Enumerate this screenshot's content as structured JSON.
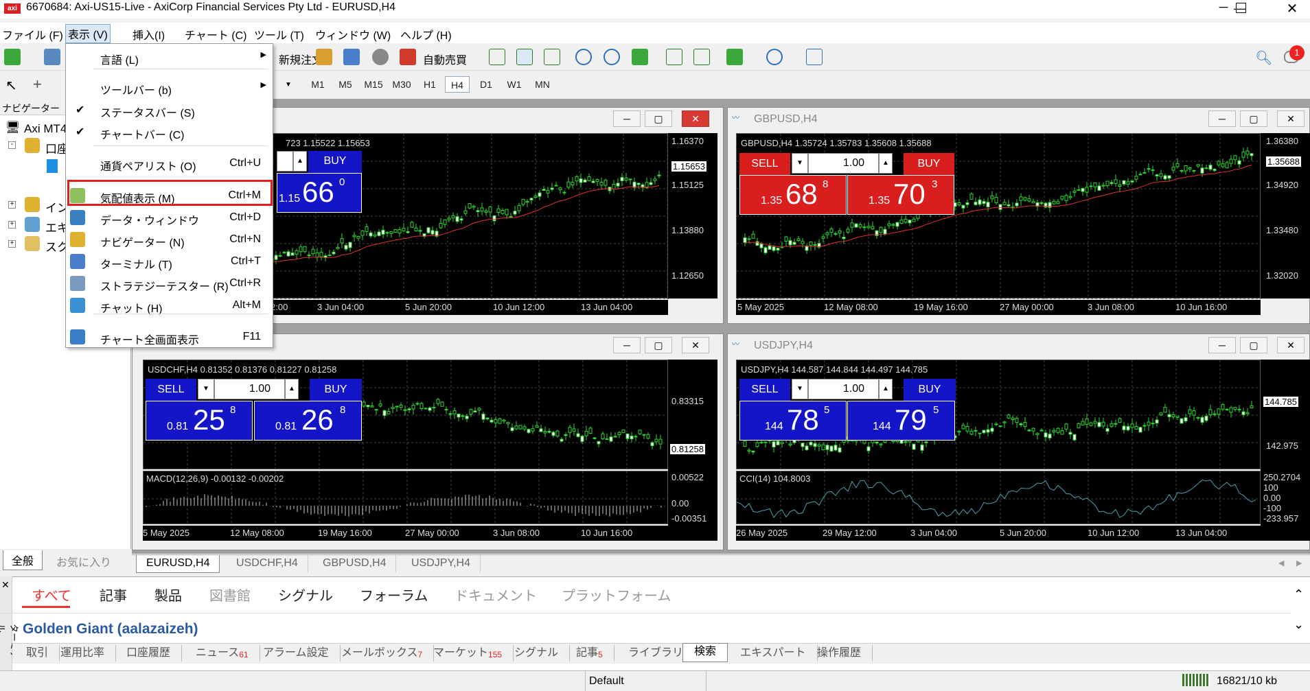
{
  "window": {
    "title": "6670684: Axi-US15-Live - AxiCorp Financial Services Pty Ltd - EURUSD,H4",
    "app_icon": "axi"
  },
  "menubar": {
    "items": [
      "ファイル (F)",
      "表示 (V)",
      "挿入(I)",
      "チャート (C)",
      "ツール (T)",
      "ウィンドウ (W)",
      "ヘルプ (H)"
    ]
  },
  "toolbar": {
    "new_order": "新規注文",
    "auto_trade": "自動売買",
    "notification_count": "1"
  },
  "timeframes": [
    "M1",
    "M5",
    "M15",
    "M30",
    "H1",
    "H4",
    "D1",
    "W1",
    "MN"
  ],
  "navigator": {
    "title": "ナビゲーター",
    "items": [
      "Axi MT4",
      "口座",
      "イン",
      "エキ",
      "スク"
    ],
    "tabs": [
      "全般",
      "お気に入り"
    ]
  },
  "view_menu": {
    "items": [
      {
        "label": "言語 (L)",
        "shortcut": "",
        "submenu": true
      },
      {
        "label": "ツールバー (b)",
        "shortcut": "",
        "submenu": true
      },
      {
        "label": "ステータスバー (S)",
        "shortcut": "",
        "checked": true
      },
      {
        "label": "チャートバー (C)",
        "shortcut": "",
        "checked": true
      },
      {
        "label": "通貨ペアリスト (O)",
        "shortcut": "Ctrl+U"
      },
      {
        "label": "気配値表示 (M)",
        "shortcut": "Ctrl+M",
        "highlighted": true
      },
      {
        "label": "データ・ウィンドウ",
        "shortcut": "Ctrl+D"
      },
      {
        "label": "ナビゲーター (N)",
        "shortcut": "Ctrl+N"
      },
      {
        "label": "ターミナル (T)",
        "shortcut": "Ctrl+T"
      },
      {
        "label": "ストラテジーテスター (R)",
        "shortcut": "Ctrl+R"
      },
      {
        "label": "チャット (H)",
        "shortcut": "Alt+M"
      },
      {
        "label": "チャート全画面表示",
        "shortcut": "F11"
      }
    ]
  },
  "charts": {
    "eurusd": {
      "info": "723 1.15522 1.15653",
      "buy_label": "BUY",
      "buy_prefix": "1.15",
      "buy_big": "66",
      "buy_sup": "0",
      "y_ticks": [
        "1.16370",
        "1.15653",
        "1.15125",
        "1.13880",
        "1.12650"
      ],
      "x_ticks": [
        "2:00",
        "3 Jun 04:00",
        "5 Jun 20:00",
        "10 Jun 12:00",
        "13 Jun 04:00"
      ],
      "current": "1.15653"
    },
    "gbpusd": {
      "title": "GBPUSD,H4",
      "info": "GBPUSD,H4  1.35724 1.35783 1.35608 1.35688",
      "sell_label": "SELL",
      "buy_label": "BUY",
      "lot": "1.00",
      "sell_prefix": "1.35",
      "sell_big": "68",
      "sell_sup": "8",
      "buy_prefix": "1.35",
      "buy_big": "70",
      "buy_sup": "3",
      "y_ticks": [
        "1.36380",
        "1.35688",
        "1.34920",
        "1.33480",
        "1.32020"
      ],
      "x_ticks": [
        "5 May 2025",
        "12 May 08:00",
        "19 May 16:00",
        "27 May 00:00",
        "3 Jun 08:00",
        "10 Jun 16:00"
      ]
    },
    "usdchf": {
      "info": "USDCHF,H4  0.81352 0.81376 0.81227 0.81258",
      "sell_label": "SELL",
      "buy_label": "BUY",
      "lot": "1.00",
      "sell_prefix": "0.81",
      "sell_big": "25",
      "sell_sup": "8",
      "buy_prefix": "0.81",
      "buy_big": "26",
      "buy_sup": "8",
      "y_ticks": [
        "0.83315",
        "0.81258"
      ],
      "macd_label": "MACD(12,26,9) -0.00132 -0.00202",
      "macd_ticks": [
        "0.00522",
        "0.00",
        "-0.00351"
      ],
      "x_ticks": [
        "5 May 2025",
        "12 May 08:00",
        "19 May 16:00",
        "27 May 00:00",
        "3 Jun 08:00",
        "10 Jun 16:00"
      ]
    },
    "usdjpy": {
      "title": "USDJPY,H4",
      "info": "USDJPY,H4  144.587 144.844 144.497 144.785",
      "sell_label": "SELL",
      "buy_label": "BUY",
      "lot": "1.00",
      "sell_prefix": "144",
      "sell_big": "78",
      "sell_sup": "5",
      "buy_prefix": "144",
      "buy_big": "79",
      "buy_sup": "5",
      "y_ticks": [
        "144.785",
        "142.975"
      ],
      "cci_label": "CCI(14) 104.8003",
      "cci_ticks": [
        "250.2704",
        "100",
        "0.00",
        "-100",
        "-233.957"
      ],
      "x_ticks": [
        "26 May 2025",
        "29 May 12:00",
        "3 Jun 04:00",
        "5 Jun 20:00",
        "10 Jun 12:00",
        "13 Jun 04:00"
      ]
    }
  },
  "chart_tabs": [
    "EURUSD,H4",
    "USDCHF,H4",
    "GBPUSD,H4",
    "USDJPY,H4"
  ],
  "terminal": {
    "side_label": "ターミナル",
    "tabs": [
      "すべて",
      "記事",
      "製品",
      "図書館",
      "シグナル",
      "フォーラム",
      "ドキュメント",
      "プラットフォーム"
    ],
    "highlight_text": "Golden Giant (aalazaizeh)",
    "bottom_tabs": [
      {
        "label": "取引",
        "count": ""
      },
      {
        "label": "運用比率",
        "count": ""
      },
      {
        "label": "口座履歴",
        "count": ""
      },
      {
        "label": "ニュース",
        "count": "61"
      },
      {
        "label": "アラーム設定",
        "count": ""
      },
      {
        "label": "メールボックス",
        "count": "7"
      },
      {
        "label": "マーケット",
        "count": "155"
      },
      {
        "label": "シグナル",
        "count": ""
      },
      {
        "label": "記事",
        "count": "5"
      },
      {
        "label": "ライブラリ",
        "count": ""
      },
      {
        "label": "検索",
        "count": ""
      },
      {
        "label": "エキスパート",
        "count": ""
      },
      {
        "label": "操作履歴",
        "count": ""
      }
    ]
  },
  "status": {
    "profile": "Default",
    "traffic": "16821/10 kb"
  },
  "colors": {
    "sell": "#d91e1e",
    "buy_blue": "#1515c8",
    "candle": "#2fd62f",
    "ma": "#e03030",
    "highlight_border": "#e0201c"
  }
}
